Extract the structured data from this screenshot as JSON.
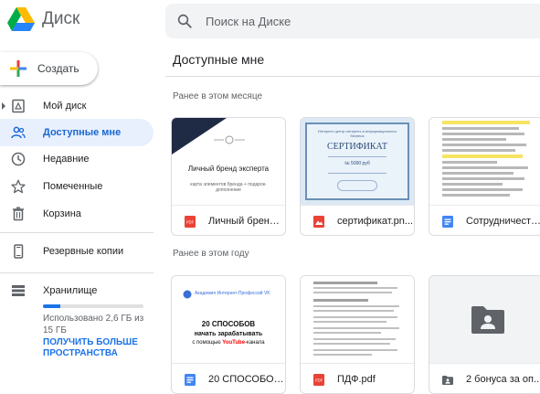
{
  "app": {
    "name": "Диск"
  },
  "search": {
    "placeholder": "Поиск на Диске"
  },
  "sidebar": {
    "create_label": "Создать",
    "items": [
      {
        "label": "Мой диск"
      },
      {
        "label": "Доступные мне"
      },
      {
        "label": "Недавние"
      },
      {
        "label": "Помеченные"
      },
      {
        "label": "Корзина"
      },
      {
        "label": "Резервные копии"
      }
    ],
    "storage": {
      "label": "Хранилище",
      "usage_text": "Использовано 2,6 ГБ из 15 ГБ",
      "used_fraction": 0.17,
      "upgrade_label": "ПОЛУЧИТЬ БОЛЬШЕ ПРОСТРАНСТВА"
    }
  },
  "main": {
    "title": "Доступные мне",
    "sections": [
      {
        "label": "Ранее в этом месяце",
        "files": [
          {
            "name": "Личный бренд ...",
            "type_icon": "pdf-icon",
            "thumb_title": "Личный бренд эксперта",
            "thumb_subtitle": "карта элементов бренда + подарок-дополнение"
          },
          {
            "name": "сертификат.pn...",
            "type_icon": "image-icon",
            "thumb_title": "СЕРТИФИКАТ",
            "thumb_header": "Интернет-центр интернет-и информационного бизнеса",
            "thumb_number": "№ 5000 руб"
          },
          {
            "name": "Сотрудничеств...",
            "type_icon": "docs-icon"
          }
        ]
      },
      {
        "label": "Ранее в этом году",
        "files": [
          {
            "name": "20 СПОСОБОВ ...",
            "type_icon": "docs-icon",
            "thumb_brand": "Академия Интернет-Профессий VK",
            "thumb_title": "20 СПОСОБОВ",
            "thumb_line2": "начать зарабатывать",
            "thumb_line3a": "с помощью ",
            "thumb_line3b": "YouTube",
            "thumb_line3c": "-канала"
          },
          {
            "name": "ПДФ.pdf",
            "type_icon": "pdf-icon"
          },
          {
            "name": "2 бонуса за оп...",
            "type_icon": "shared-folder-icon"
          }
        ]
      }
    ]
  },
  "colors": {
    "accent": "#1a73e8",
    "active_bg": "#e8f0fe",
    "pdf": "#ea4335",
    "docs": "#4285f4",
    "youtube": "#ff0000"
  }
}
